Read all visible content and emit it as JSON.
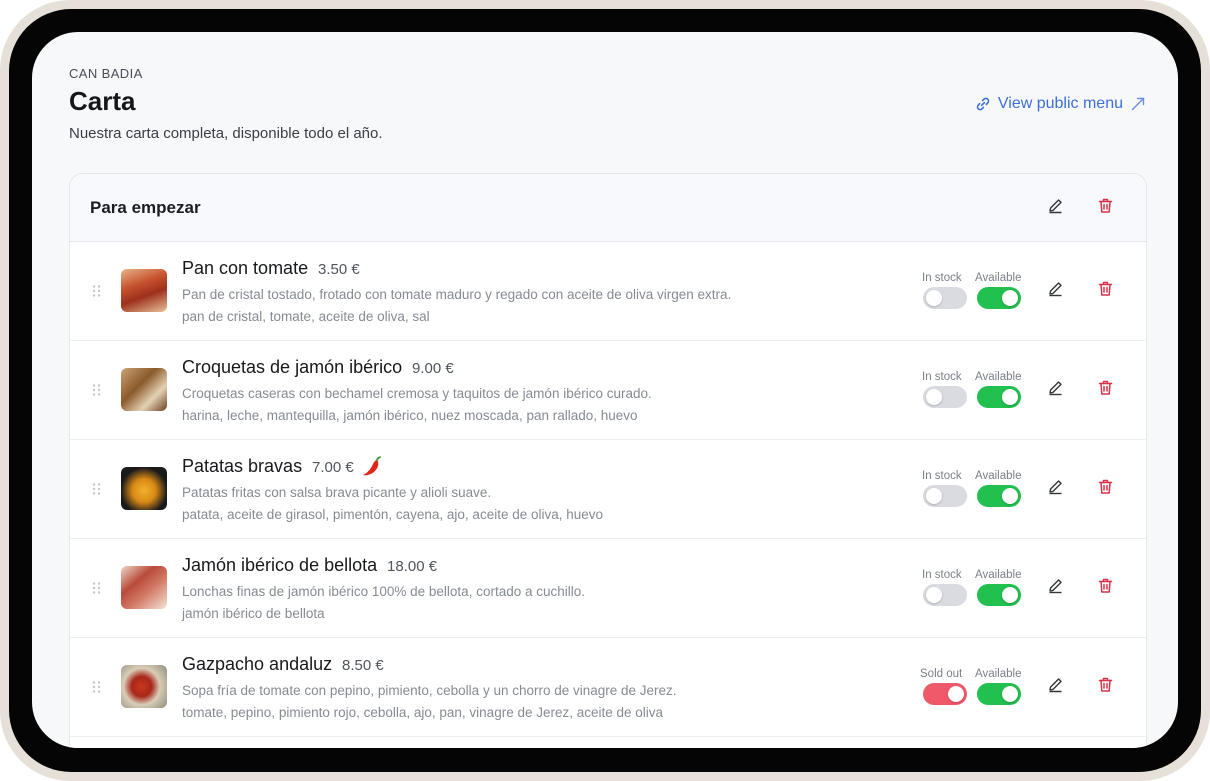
{
  "page": {
    "eyebrow": "CAN BADIA",
    "title": "Carta",
    "subtitle": "Nuestra carta completa, disponible todo el año.",
    "public_link": "View public menu"
  },
  "section": {
    "title": "Para empezar"
  },
  "items": [
    {
      "name": "Pan con tomate",
      "price": "3.50 €",
      "description": "Pan de cristal tostado, frotado con tomate maduro y regado con aceite de oliva virgen extra.",
      "ingredients": "pan de cristal, tomate, aceite de oliva, sal",
      "stock_label": "In stock",
      "available_label": "Available",
      "in_stock": true,
      "available": true,
      "spicy": false
    },
    {
      "name": "Croquetas de jamón ibérico",
      "price": "9.00 €",
      "description": "Croquetas caseras con bechamel cremosa y taquitos de jamón ibérico curado.",
      "ingredients": "harina, leche, mantequilla, jamón ibérico, nuez moscada, pan rallado, huevo",
      "stock_label": "In stock",
      "available_label": "Available",
      "in_stock": true,
      "available": true,
      "spicy": false
    },
    {
      "name": "Patatas bravas",
      "price": "7.00 €",
      "description": "Patatas fritas con salsa brava picante y alioli suave.",
      "ingredients": "patata, aceite de girasol, pimentón, cayena, ajo, aceite de oliva, huevo",
      "stock_label": "In stock",
      "available_label": "Available",
      "in_stock": true,
      "available": true,
      "spicy": true
    },
    {
      "name": "Jamón ibérico de bellota",
      "price": "18.00 €",
      "description": "Lonchas finas de jamón ibérico 100% de bellota, cortado a cuchillo.",
      "ingredients": "jamón ibérico de bellota",
      "stock_label": "In stock",
      "available_label": "Available",
      "in_stock": true,
      "available": true,
      "spicy": false
    },
    {
      "name": "Gazpacho andaluz",
      "price": "8.50 €",
      "description": "Sopa fría de tomate con pepino, pimiento, cebolla y un chorro de vinagre de Jerez.",
      "ingredients": "tomate, pepino, pimiento rojo, cebolla, ajo, pan, vinagre de Jerez, aceite de oliva",
      "stock_label": "Sold out",
      "available_label": "Available",
      "in_stock": false,
      "available": true,
      "spicy": false
    }
  ],
  "colors": {
    "link": "#3d6fd9",
    "toggle_on": "#22c04e",
    "toggle_off": "#d9dbe0",
    "toggle_sold_out": "#f0596a",
    "delete": "#d6334a"
  },
  "icons": {
    "link": "link-icon",
    "external": "external-arrow-icon",
    "edit": "pencil-icon",
    "delete": "trash-icon",
    "drag": "drag-handle-icon",
    "spicy": "chili-pepper-icon"
  }
}
